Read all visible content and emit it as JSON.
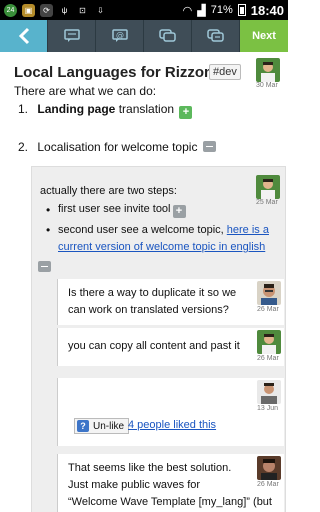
{
  "status_bar": {
    "left_badge": "24",
    "signal": "71%",
    "time": "18:40"
  },
  "toolbar": {
    "back_icon": "back-arrow-icon",
    "buttons": [
      "comment-icon",
      "mention-icon",
      "topics-icon",
      "chat-icon"
    ],
    "next_label": "Next"
  },
  "topic": {
    "title": "Local Languages for Rizzoma",
    "tag": "#dev",
    "date": "30 Mar",
    "intro": "There are what we can do:",
    "items": [
      {
        "num": "1.",
        "bold": "Landing page",
        "rest": " translation"
      },
      {
        "num": "2.",
        "bold": "",
        "rest": "Localisation for welcome topic"
      }
    ]
  },
  "thread": {
    "blip": {
      "date": "25 Mar",
      "text": "actually there are two steps:",
      "bullets": [
        {
          "text": "first user see invite tool",
          "link": ""
        },
        {
          "text": "second user see a welcome topic, ",
          "link": "here is a current version of welcome topic in english"
        }
      ]
    },
    "replies": [
      {
        "lines": [
          "Is there a way to duplicate it so we",
          "can work on translated versions?"
        ],
        "date": "26 Mar"
      },
      {
        "lines": [
          "you can copy all content and past it"
        ],
        "date": "26 Mar"
      },
      {
        "lines": [],
        "date": "13 Jun",
        "unlike_label": "Un-like",
        "likes": "4 people liked this"
      },
      {
        "lines": [
          "That seems like the best solution.",
          "Just make public waves for",
          "“Welcome Wave Template [my_lang]” (but"
        ],
        "date": "26 Mar"
      }
    ]
  },
  "colors": {
    "toolbar": "#3f4d57",
    "back": "#58b3cc",
    "next": "#7bc143",
    "link": "#1a55c0"
  }
}
